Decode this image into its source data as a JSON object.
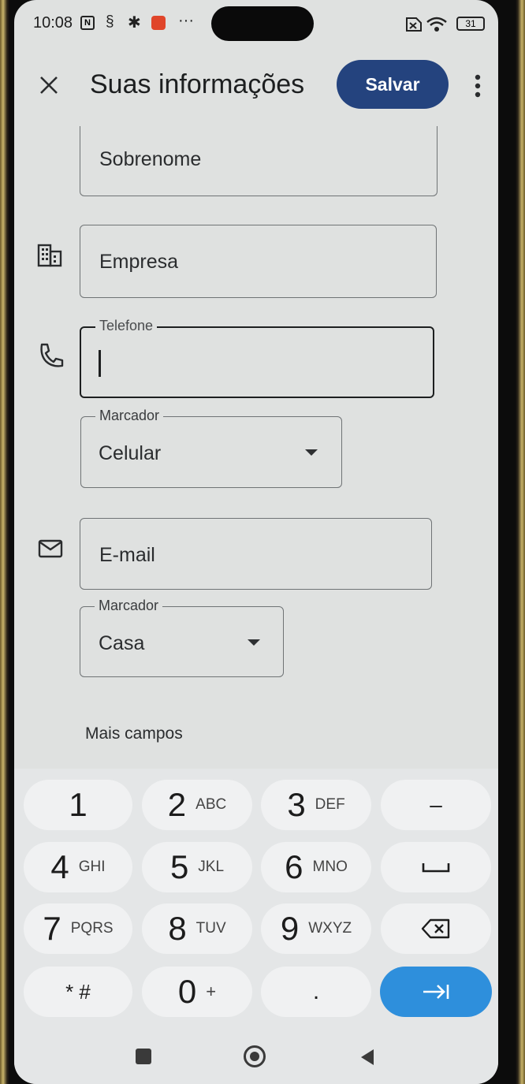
{
  "status_bar": {
    "time": "10:08",
    "overflow": "···",
    "battery": "31"
  },
  "app_bar": {
    "title": "Suas informações",
    "save_label": "Salvar"
  },
  "fields": {
    "last_name": {
      "placeholder": "Sobrenome"
    },
    "company": {
      "placeholder": "Empresa"
    },
    "phone": {
      "label": "Telefone",
      "value": ""
    },
    "phone_label": {
      "legend": "Marcador",
      "value": "Celular"
    },
    "email": {
      "placeholder": "E-mail"
    },
    "email_label": {
      "legend": "Marcador",
      "value": "Casa"
    }
  },
  "more_fields": "Mais campos",
  "keyboard": {
    "keys": [
      {
        "num": "1",
        "sub": ""
      },
      {
        "num": "2",
        "sub": "ABC"
      },
      {
        "num": "3",
        "sub": "DEF"
      },
      {
        "num": "4",
        "sub": "GHI"
      },
      {
        "num": "5",
        "sub": "JKL"
      },
      {
        "num": "6",
        "sub": "MNO"
      },
      {
        "num": "7",
        "sub": "PQRS"
      },
      {
        "num": "8",
        "sub": "TUV"
      },
      {
        "num": "9",
        "sub": "WXYZ"
      },
      {
        "num": "0",
        "sub": "+"
      }
    ],
    "symbols": "* #",
    "dot": ".",
    "dash": "–"
  },
  "colors": {
    "accent": "#24437e",
    "next_key": "#2e8fdc",
    "background": "#dfe1e0"
  },
  "icons": [
    "close-icon",
    "more-vert-icon",
    "business-icon",
    "phone-icon",
    "mail-icon",
    "dropdown-arrow-icon",
    "backspace-icon",
    "space-icon",
    "next-field-icon",
    "nav-recents-icon",
    "nav-home-icon",
    "nav-back-icon"
  ]
}
